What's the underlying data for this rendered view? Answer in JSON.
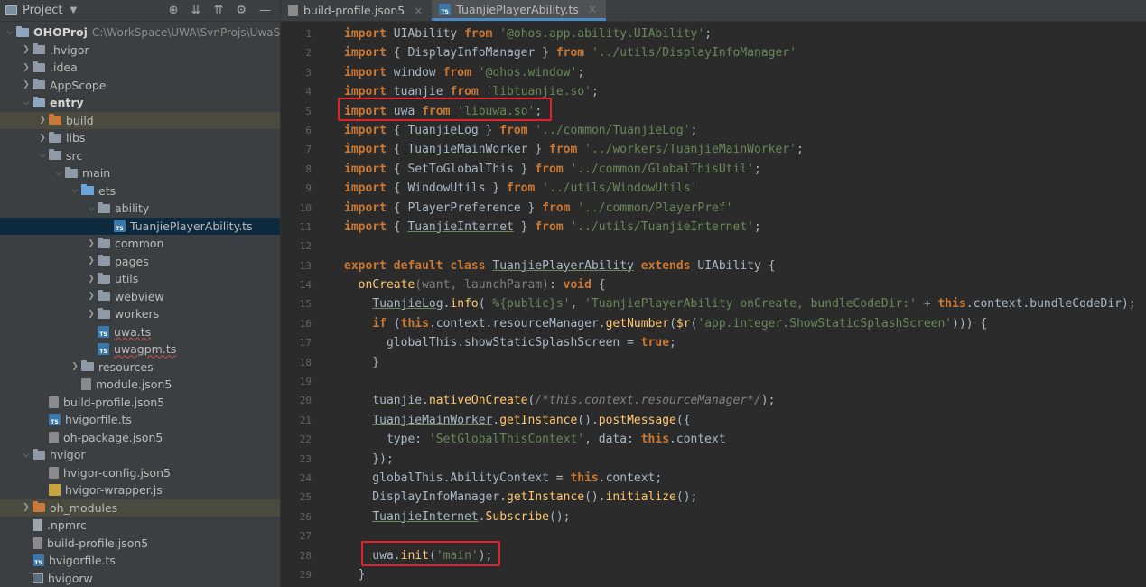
{
  "project_panel": {
    "title": "Project",
    "tree": [
      {
        "label": "OHOProj",
        "hint": "C:\\WorkSpace\\UWA\\SvnProjs\\UwaSdk",
        "level": 0,
        "open": true,
        "kind": "module",
        "bold": true
      },
      {
        "label": ".hvigor",
        "level": 1,
        "open": false,
        "kind": "folder"
      },
      {
        "label": ".idea",
        "level": 1,
        "open": false,
        "kind": "folder"
      },
      {
        "label": "AppScope",
        "level": 1,
        "open": false,
        "kind": "folder"
      },
      {
        "label": "entry",
        "level": 1,
        "open": true,
        "kind": "module",
        "bold": true
      },
      {
        "label": "build",
        "level": 2,
        "open": false,
        "kind": "folder-orange",
        "highlight": true
      },
      {
        "label": "libs",
        "level": 2,
        "open": false,
        "kind": "folder"
      },
      {
        "label": "src",
        "level": 2,
        "open": true,
        "kind": "folder"
      },
      {
        "label": "main",
        "level": 3,
        "open": true,
        "kind": "folder"
      },
      {
        "label": "ets",
        "level": 4,
        "open": true,
        "kind": "folder-blue"
      },
      {
        "label": "ability",
        "level": 5,
        "open": true,
        "kind": "folder"
      },
      {
        "label": "TuanjiePlayerAbility.ts",
        "level": 6,
        "kind": "ts",
        "selected": true
      },
      {
        "label": "common",
        "level": 5,
        "open": false,
        "kind": "folder"
      },
      {
        "label": "pages",
        "level": 5,
        "open": false,
        "kind": "folder"
      },
      {
        "label": "utils",
        "level": 5,
        "open": false,
        "kind": "folder"
      },
      {
        "label": "webview",
        "level": 5,
        "open": false,
        "kind": "folder"
      },
      {
        "label": "workers",
        "level": 5,
        "open": false,
        "kind": "folder"
      },
      {
        "label": "uwa.ts",
        "level": 5,
        "kind": "ts",
        "squiggle": true
      },
      {
        "label": "uwagpm.ts",
        "level": 5,
        "kind": "ts",
        "squiggle": true
      },
      {
        "label": "resources",
        "level": 4,
        "open": false,
        "kind": "folder"
      },
      {
        "label": "module.json5",
        "level": 4,
        "kind": "json"
      },
      {
        "label": "build-profile.json5",
        "level": 2,
        "kind": "json"
      },
      {
        "label": "hvigorfile.ts",
        "level": 2,
        "kind": "ts"
      },
      {
        "label": "oh-package.json5",
        "level": 2,
        "kind": "json"
      },
      {
        "label": "hvigor",
        "level": 1,
        "open": true,
        "kind": "folder"
      },
      {
        "label": "hvigor-config.json5",
        "level": 2,
        "kind": "json"
      },
      {
        "label": "hvigor-wrapper.js",
        "level": 2,
        "kind": "js"
      },
      {
        "label": "oh_modules",
        "level": 1,
        "open": false,
        "kind": "folder-orange",
        "highlight": true
      },
      {
        "label": ".npmrc",
        "level": 1,
        "kind": "plain"
      },
      {
        "label": "build-profile.json5",
        "level": 1,
        "kind": "json"
      },
      {
        "label": "hvigorfile.ts",
        "level": 1,
        "kind": "ts"
      },
      {
        "label": "hvigorw",
        "level": 1,
        "kind": "term"
      }
    ]
  },
  "tabs": [
    {
      "label": "build-profile.json5",
      "active": false,
      "kind": "json"
    },
    {
      "label": "TuanjiePlayerAbility.ts",
      "active": true,
      "kind": "ts"
    }
  ],
  "code_lines": [
    [
      [
        "kw",
        "import "
      ],
      [
        "",
        "UIAbility "
      ],
      [
        "kw",
        "from "
      ],
      [
        "str",
        "'@ohos.app.ability.UIAbility'"
      ],
      [
        "",
        ";"
      ]
    ],
    [
      [
        "kw",
        "import "
      ],
      [
        "",
        "{ DisplayInfoManager } "
      ],
      [
        "kw",
        "from "
      ],
      [
        "str",
        "'../utils/DisplayInfoManager'"
      ]
    ],
    [
      [
        "kw",
        "import "
      ],
      [
        "",
        "window "
      ],
      [
        "kw",
        "from "
      ],
      [
        "str",
        "'@ohos.window'"
      ],
      [
        "",
        ";"
      ]
    ],
    [
      [
        "kw",
        "import "
      ],
      [
        "",
        "tuanjie "
      ],
      [
        "kw",
        "from "
      ],
      [
        "str",
        "'libtuanjie.so'"
      ],
      [
        "",
        ";"
      ]
    ],
    [
      [
        "kw",
        "import "
      ],
      [
        "",
        "uwa "
      ],
      [
        "kw",
        "from "
      ],
      [
        "str u",
        "'libuwa.so'"
      ],
      [
        "",
        ";"
      ]
    ],
    [
      [
        "kw",
        "import "
      ],
      [
        "",
        "{ "
      ],
      [
        "u",
        "TuanjieLog"
      ],
      [
        "",
        " } "
      ],
      [
        "kw",
        "from "
      ],
      [
        "str",
        "'../common/TuanjieLog'"
      ],
      [
        "",
        ";"
      ]
    ],
    [
      [
        "kw",
        "import "
      ],
      [
        "",
        "{ "
      ],
      [
        "u",
        "TuanjieMainWorker"
      ],
      [
        "",
        " } "
      ],
      [
        "kw",
        "from "
      ],
      [
        "str",
        "'../workers/TuanjieMainWorker'"
      ],
      [
        "",
        ";"
      ]
    ],
    [
      [
        "kw",
        "import "
      ],
      [
        "",
        "{ SetToGlobalThis } "
      ],
      [
        "kw",
        "from "
      ],
      [
        "str",
        "'../common/GlobalThisUtil'"
      ],
      [
        "",
        ";"
      ]
    ],
    [
      [
        "kw",
        "import "
      ],
      [
        "",
        "{ WindowUtils } "
      ],
      [
        "kw",
        "from "
      ],
      [
        "str",
        "'../utils/WindowUtils'"
      ]
    ],
    [
      [
        "kw",
        "import "
      ],
      [
        "",
        "{ PlayerPreference } "
      ],
      [
        "kw",
        "from "
      ],
      [
        "str",
        "'../common/PlayerPref'"
      ]
    ],
    [
      [
        "kw",
        "import "
      ],
      [
        "",
        "{ "
      ],
      [
        "u",
        "TuanjieInternet"
      ],
      [
        "",
        " } "
      ],
      [
        "kw",
        "from "
      ],
      [
        "str",
        "'../utils/TuanjieInternet'"
      ],
      [
        "",
        ";"
      ]
    ],
    [],
    [
      [
        "kw",
        "export default class "
      ],
      [
        "u",
        "TuanjiePlayerAbility"
      ],
      [
        "kw",
        " extends "
      ],
      [
        "",
        "UIAbility {"
      ]
    ],
    [
      [
        "",
        "  "
      ],
      [
        "fn",
        "onCreate"
      ],
      [
        "gray",
        "(want, launchParam)"
      ],
      [
        "",
        ": "
      ],
      [
        "kw",
        "void "
      ],
      [
        "",
        "{"
      ]
    ],
    [
      [
        "",
        "    "
      ],
      [
        "u",
        "TuanjieLog"
      ],
      [
        "",
        "."
      ],
      [
        "fn",
        "info"
      ],
      [
        "",
        "("
      ],
      [
        "str",
        "'%{public}s'"
      ],
      [
        "",
        ", "
      ],
      [
        "str",
        "'TuanjiePlayerAbility onCreate, bundleCodeDir:' "
      ],
      [
        "",
        "+ "
      ],
      [
        "kw",
        "this"
      ],
      [
        "",
        ".context.bundleCodeDir);"
      ]
    ],
    [
      [
        "",
        "    "
      ],
      [
        "kw",
        "if "
      ],
      [
        "",
        "("
      ],
      [
        "kw",
        "this"
      ],
      [
        "",
        ".context.resourceManager."
      ],
      [
        "fn",
        "getNumber"
      ],
      [
        "",
        "("
      ],
      [
        "fn",
        "$r"
      ],
      [
        "",
        "("
      ],
      [
        "str",
        "'app.integer.ShowStaticSplashScreen'"
      ],
      [
        "",
        ")))"
      ],
      [
        "",
        " {"
      ]
    ],
    [
      [
        "",
        "      globalThis.showStaticSplashScreen = "
      ],
      [
        "kw",
        "true"
      ],
      [
        "",
        ";"
      ]
    ],
    [
      [
        "",
        "    }"
      ]
    ],
    [],
    [
      [
        "",
        "    "
      ],
      [
        "u",
        "tuanjie"
      ],
      [
        "",
        "."
      ],
      [
        "fn",
        "nativeOnCreate"
      ],
      [
        "",
        "("
      ],
      [
        "cmt",
        "/*this.context.resourceManager*/"
      ],
      [
        "",
        ");"
      ]
    ],
    [
      [
        "",
        "    "
      ],
      [
        "u",
        "TuanjieMainWorker"
      ],
      [
        "",
        "."
      ],
      [
        "fn",
        "getInstance"
      ],
      [
        "",
        "()."
      ],
      [
        "fn",
        "postMessage"
      ],
      [
        "",
        "({"
      ]
    ],
    [
      [
        "",
        "      type: "
      ],
      [
        "str",
        "'SetGlobalThisContext'"
      ],
      [
        "",
        ", data: "
      ],
      [
        "kw",
        "this"
      ],
      [
        "",
        ".context"
      ]
    ],
    [
      [
        "",
        "    });"
      ]
    ],
    [
      [
        "",
        "    globalThis.AbilityContext = "
      ],
      [
        "kw",
        "this"
      ],
      [
        "",
        ".context;"
      ]
    ],
    [
      [
        "",
        "    DisplayInfoManager."
      ],
      [
        "fn",
        "getInstance"
      ],
      [
        "",
        "()."
      ],
      [
        "fn",
        "initialize"
      ],
      [
        "",
        "();"
      ]
    ],
    [
      [
        "",
        "    "
      ],
      [
        "u",
        "TuanjieInternet"
      ],
      [
        "",
        "."
      ],
      [
        "fn",
        "Subscribe"
      ],
      [
        "",
        "();"
      ]
    ],
    [],
    [
      [
        "",
        "    uwa."
      ],
      [
        "fn",
        "init"
      ],
      [
        "",
        "("
      ],
      [
        "str",
        "'main'"
      ],
      [
        "",
        ");"
      ]
    ],
    [
      [
        "",
        "  }"
      ]
    ]
  ]
}
